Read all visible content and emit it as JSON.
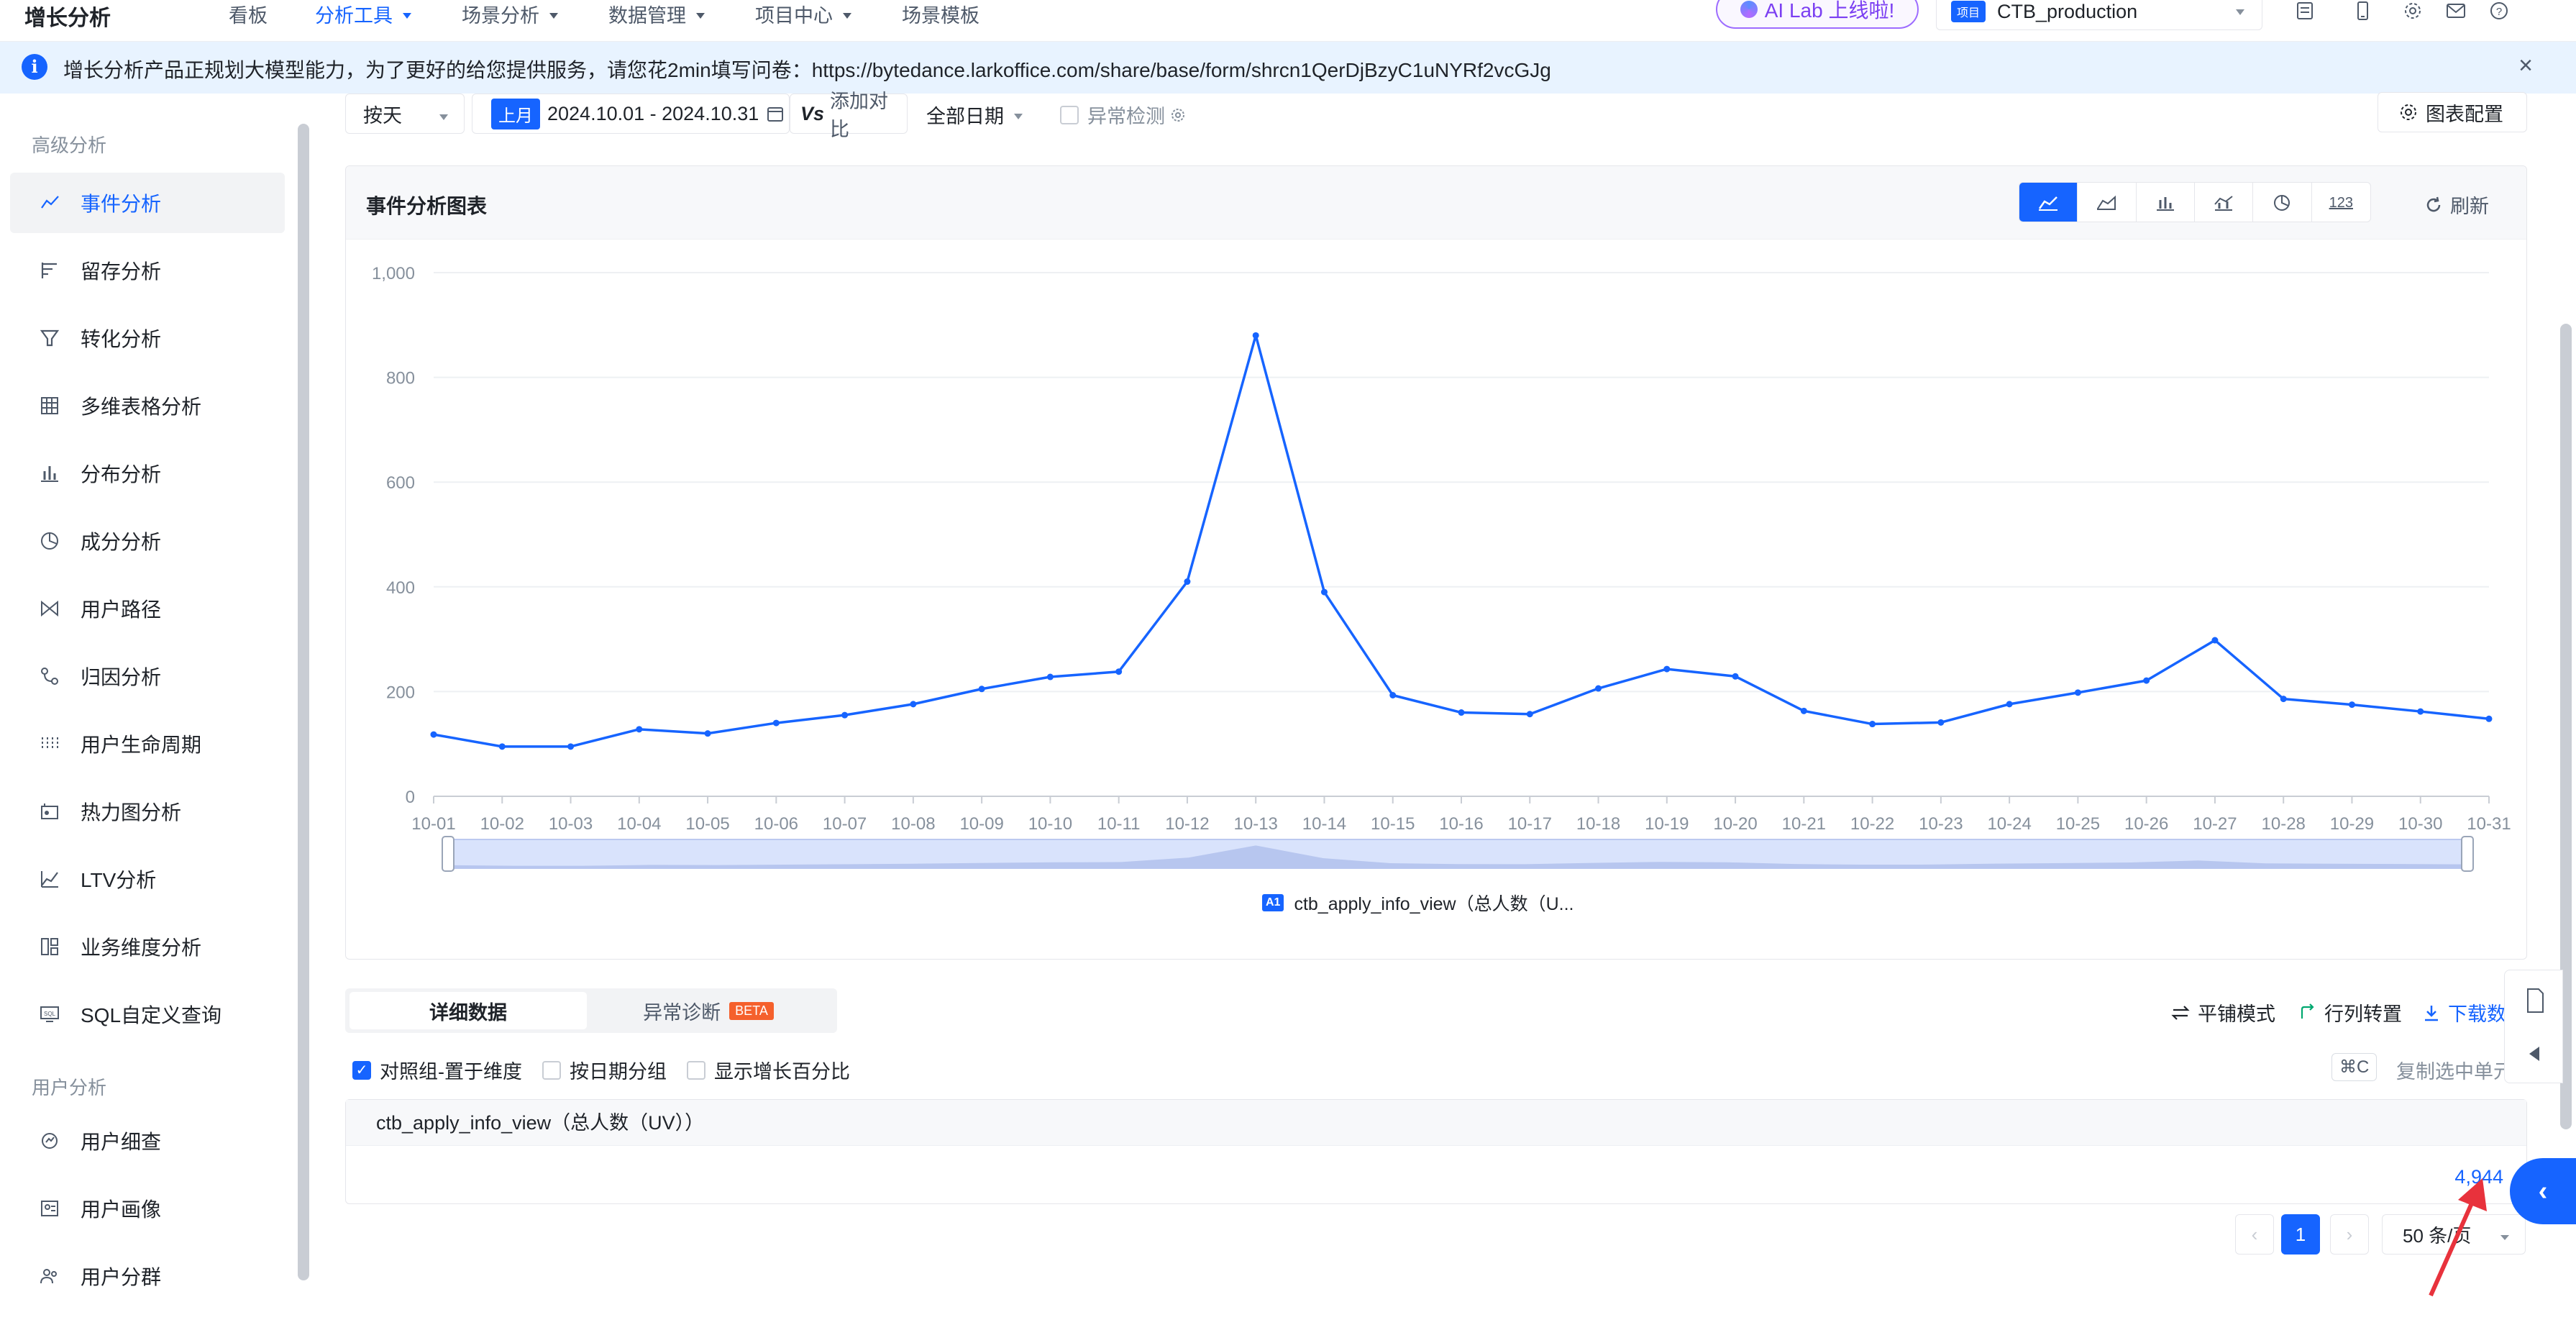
{
  "app": {
    "brand": "增长分析",
    "nav": [
      {
        "label": "看板",
        "active": false,
        "caret": false
      },
      {
        "label": "分析工具",
        "active": true,
        "caret": true
      },
      {
        "label": "场景分析",
        "active": false,
        "caret": true
      },
      {
        "label": "数据管理",
        "active": false,
        "caret": true
      },
      {
        "label": "项目中心",
        "active": false,
        "caret": true
      },
      {
        "label": "场景模板",
        "active": false,
        "caret": false
      }
    ],
    "ai_lab": "AI Lab 上线啦!",
    "project_tag": "项目",
    "project_name": "CTB_production"
  },
  "banner": {
    "text": "增长分析产品正规划大模型能力，为了更好的给您提供服务，请您花2min填写问卷：https://bytedance.larkoffice.com/share/base/form/shrcn1QerDjBzyC1uNYRf2vcGJg",
    "close": "×"
  },
  "sidebar": {
    "section1": "高级分析",
    "items1": [
      {
        "label": "事件分析",
        "icon": "line-chart-icon",
        "active": true
      },
      {
        "label": "留存分析",
        "icon": "retention-icon",
        "active": false
      },
      {
        "label": "转化分析",
        "icon": "funnel-icon",
        "active": false
      },
      {
        "label": "多维表格分析",
        "icon": "table-icon",
        "active": false
      },
      {
        "label": "分布分析",
        "icon": "bar-chart-icon",
        "active": false
      },
      {
        "label": "成分分析",
        "icon": "pie-chart-icon",
        "active": false
      },
      {
        "label": "用户路径",
        "icon": "path-icon",
        "active": false
      },
      {
        "label": "归因分析",
        "icon": "attribution-icon",
        "active": false
      },
      {
        "label": "用户生命周期",
        "icon": "lifecycle-icon",
        "active": false
      },
      {
        "label": "热力图分析",
        "icon": "heatmap-icon",
        "active": false
      },
      {
        "label": "LTV分析",
        "icon": "ltv-icon",
        "active": false
      },
      {
        "label": "业务维度分析",
        "icon": "dimension-icon",
        "active": false
      },
      {
        "label": "SQL自定义查询",
        "icon": "sql-icon",
        "active": false
      }
    ],
    "section2": "用户分析",
    "items2": [
      {
        "label": "用户细查",
        "icon": "user-search-icon",
        "active": false
      },
      {
        "label": "用户画像",
        "icon": "user-profile-icon",
        "active": false
      },
      {
        "label": "用户分群",
        "icon": "user-group-icon",
        "active": false
      }
    ]
  },
  "toolbar": {
    "granularity": "按天",
    "period_tag": "上月",
    "date_range": "2024.10.01 - 2024.10.31",
    "compare": "添加对比",
    "compare_prefix": "Vs",
    "all_dates": "全部日期",
    "anomaly": "异常检测",
    "chart_config": "图表配置"
  },
  "chart_card": {
    "title": "事件分析图表",
    "types": [
      "line-chart-icon",
      "area-chart-icon",
      "bar-chart-icon",
      "combo-chart-icon",
      "pie-chart-icon",
      "number-icon"
    ],
    "number_label": "123",
    "refresh": "刷新"
  },
  "chart_data": {
    "type": "line",
    "x": [
      "10-01",
      "10-02",
      "10-03",
      "10-04",
      "10-05",
      "10-06",
      "10-07",
      "10-08",
      "10-09",
      "10-10",
      "10-11",
      "10-12",
      "10-13",
      "10-14",
      "10-15",
      "10-16",
      "10-17",
      "10-18",
      "10-19",
      "10-20",
      "10-21",
      "10-22",
      "10-23",
      "10-24",
      "10-25",
      "10-26",
      "10-27",
      "10-28",
      "10-29",
      "10-30",
      "10-31"
    ],
    "series": [
      {
        "name": "ctb_apply_info_view（总人数（U...",
        "color": "#1664ff",
        "values": [
          118,
          95,
          95,
          128,
          120,
          140,
          155,
          176,
          205,
          228,
          238,
          410,
          880,
          390,
          193,
          160,
          157,
          206,
          243,
          229,
          163,
          138,
          141,
          176,
          198,
          221,
          298,
          186,
          175,
          162,
          148
        ]
      }
    ],
    "yticks": [
      "0",
      "200",
      "400",
      "600",
      "800",
      "1,000"
    ],
    "ylim": [
      0,
      1000
    ],
    "grid": true,
    "legend_position": "bottom",
    "legend_badge": "A1"
  },
  "detail": {
    "tab_detail": "详细数据",
    "tab_anomaly": "异常诊断",
    "beta": "BETA",
    "tile_mode": "平铺模式",
    "transpose": "行列转置",
    "download": "下载数",
    "check_compare": "对照组-置于维度",
    "check_date_group": "按日期分组",
    "check_growth": "显示增长百分比",
    "copy_kbd": "⌘C",
    "copy_label": "复制选中单元",
    "column_header": "ctb_apply_info_view（总人数（UV））",
    "total_value": "4,944",
    "page": "1",
    "page_size": "50 条/页"
  }
}
